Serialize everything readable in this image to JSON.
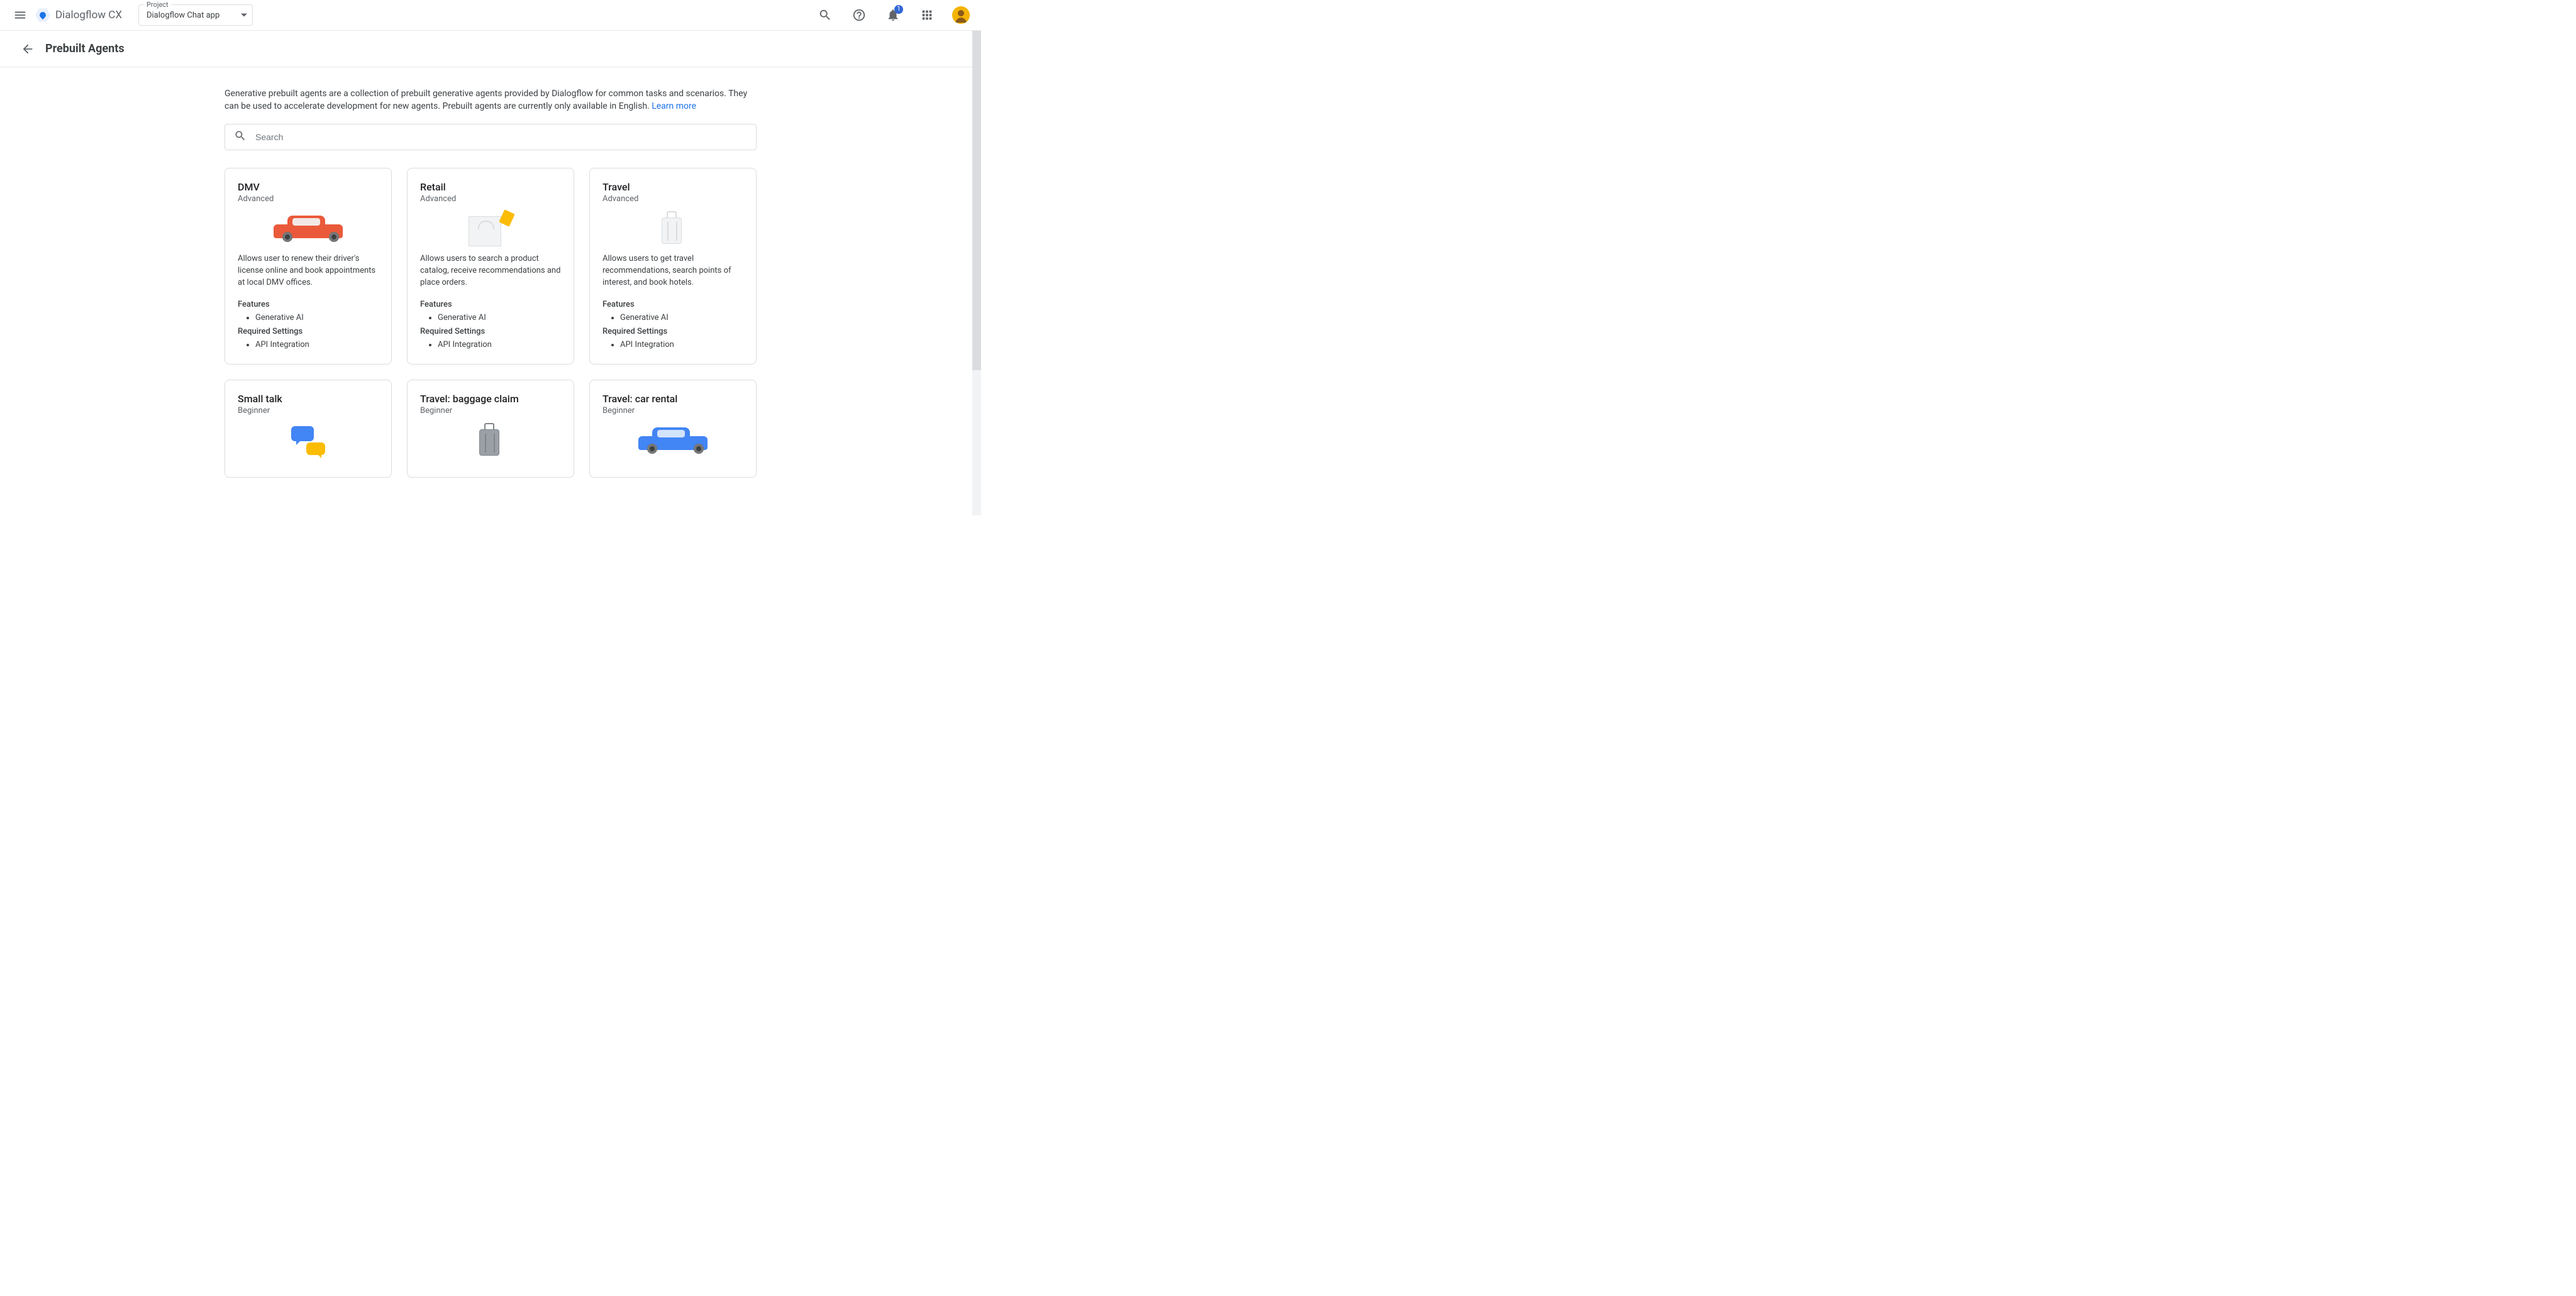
{
  "topbar": {
    "brand": "Dialogflow CX",
    "project_label": "Project",
    "project_value": "Dialogflow Chat app",
    "notif_count": "1"
  },
  "secondbar": {
    "page_title": "Prebuilt Agents"
  },
  "intro": {
    "text": "Generative prebuilt agents are a collection of prebuilt generative agents provided by Dialogflow for common tasks and scenarios. They can be used to accelerate development for new agents. Prebuilt agents are currently only available in English. ",
    "learn_more": "Learn more"
  },
  "search": {
    "placeholder": "Search"
  },
  "labels": {
    "features": "Features",
    "required_settings": "Required Settings"
  },
  "cards": [
    {
      "title": "DMV",
      "level": "Advanced",
      "illus": "car-red",
      "desc": "Allows user to renew their driver's license online and book appointments at local DMV offices.",
      "features": [
        "Generative AI"
      ],
      "required": [
        "API Integration"
      ]
    },
    {
      "title": "Retail",
      "level": "Advanced",
      "illus": "bag",
      "desc": "Allows users to search a product catalog, receive recommendations and place orders.",
      "features": [
        "Generative AI"
      ],
      "required": [
        "API Integration"
      ]
    },
    {
      "title": "Travel",
      "level": "Advanced",
      "illus": "suitcase",
      "desc": "Allows users to get travel recommendations, search points of interest, and book hotels.",
      "features": [
        "Generative AI"
      ],
      "required": [
        "API Integration"
      ]
    },
    {
      "title": "Small talk",
      "level": "Beginner",
      "illus": "chat",
      "desc": "",
      "features": [],
      "required": []
    },
    {
      "title": "Travel: baggage claim",
      "level": "Beginner",
      "illus": "suitcase-dark",
      "desc": "",
      "features": [],
      "required": []
    },
    {
      "title": "Travel: car rental",
      "level": "Beginner",
      "illus": "car-blue",
      "desc": "",
      "features": [],
      "required": []
    }
  ]
}
